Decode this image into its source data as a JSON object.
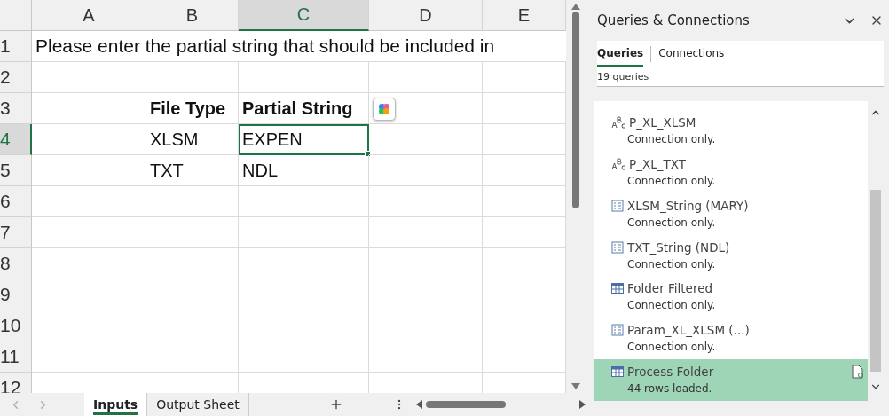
{
  "sheet": {
    "columns": [
      {
        "label": "A",
        "selected": false
      },
      {
        "label": "B",
        "selected": false
      },
      {
        "label": "C",
        "selected": true
      },
      {
        "label": "D",
        "selected": false
      },
      {
        "label": "E",
        "selected": false
      }
    ],
    "rows": [
      {
        "label": "1",
        "selected": false,
        "kind": "note",
        "text": "Please enter the partial string that should be included in"
      },
      {
        "label": "2",
        "selected": false,
        "kind": "cells",
        "cells": []
      },
      {
        "label": "3",
        "selected": false,
        "kind": "cells",
        "cells": [
          {
            "text": "File Type",
            "bold": true,
            "selected": false
          },
          {
            "text": "Partial String",
            "bold": true,
            "selected": false
          }
        ]
      },
      {
        "label": "4",
        "selected": true,
        "kind": "cells",
        "cells": [
          {
            "text": "XLSM",
            "bold": false,
            "selected": false
          },
          {
            "text": "EXPEN",
            "bold": false,
            "selected": true
          }
        ]
      },
      {
        "label": "5",
        "selected": false,
        "kind": "cells",
        "cells": [
          {
            "text": "TXT",
            "bold": false,
            "selected": false
          },
          {
            "text": "NDL",
            "bold": false,
            "selected": false
          }
        ]
      },
      {
        "label": "6",
        "selected": false,
        "kind": "cells",
        "cells": []
      },
      {
        "label": "7",
        "selected": false,
        "kind": "cells",
        "cells": []
      },
      {
        "label": "8",
        "selected": false,
        "kind": "cells",
        "cells": []
      },
      {
        "label": "9",
        "selected": false,
        "kind": "cells",
        "cells": []
      },
      {
        "label": "10",
        "selected": false,
        "kind": "cells",
        "cells": []
      },
      {
        "label": "11",
        "selected": false,
        "kind": "cells",
        "cells": []
      },
      {
        "label": "12",
        "selected": false,
        "kind": "cells",
        "cells": []
      }
    ]
  },
  "sheet_tabs": [
    {
      "label": "Inputs",
      "selected": true
    },
    {
      "label": "Output Sheet",
      "selected": false
    }
  ],
  "pane": {
    "title": "Queries & Connections",
    "tabs": [
      {
        "label": "Queries",
        "selected": true
      },
      {
        "label": "Connections",
        "selected": false
      }
    ],
    "count": "19 queries",
    "queries": [
      {
        "kind": "parameter",
        "name": "P_XL_XLSM",
        "status": "Connection only.",
        "selected": false
      },
      {
        "kind": "parameter",
        "name": "P_XL_TXT",
        "status": "Connection only.",
        "selected": false
      },
      {
        "kind": "list",
        "name": "XLSM_String (MARY)",
        "status": "Connection only.",
        "selected": false
      },
      {
        "kind": "list",
        "name": "TXT_String (NDL)",
        "status": "Connection only.",
        "selected": false
      },
      {
        "kind": "table",
        "name": "Folder Filtered",
        "status": "Connection only.",
        "selected": false
      },
      {
        "kind": "list",
        "name": "Param_XL_XLSM (...)",
        "status": "Connection only.",
        "selected": false
      },
      {
        "kind": "table",
        "name": "Process Folder",
        "status": "44 rows loaded.",
        "selected": true
      }
    ]
  }
}
